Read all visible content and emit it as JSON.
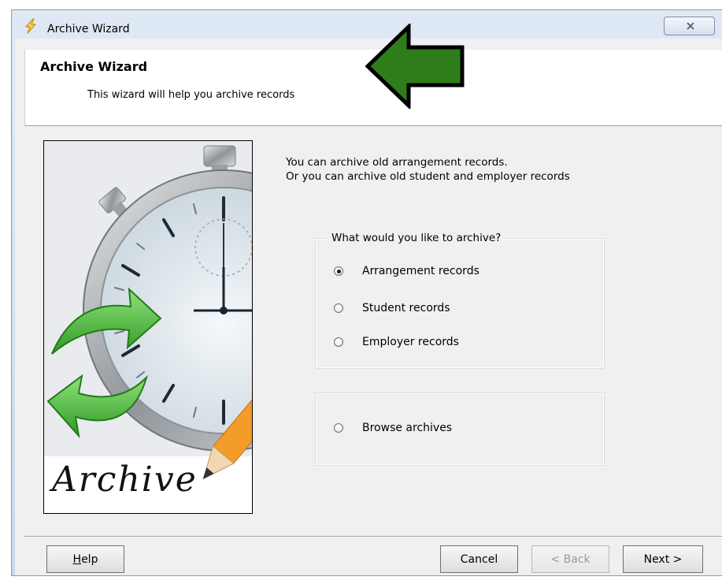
{
  "window": {
    "title": "Archive Wizard"
  },
  "header": {
    "title": "Archive Wizard",
    "subtitle": "This wizard will help you archive records"
  },
  "image": {
    "caption": "Archive"
  },
  "intro": {
    "line1": "You can archive old arrangement records.",
    "line2": "Or you can archive old student and employer records"
  },
  "archive_group": {
    "legend": "What would you  like to archive?",
    "options": [
      {
        "label": "Arrangement records",
        "checked": true
      },
      {
        "label": "Student records",
        "checked": false
      },
      {
        "label": "Employer records",
        "checked": false
      }
    ]
  },
  "browse_group": {
    "option": {
      "label": "Browse  archives",
      "checked": false
    }
  },
  "buttons": {
    "help": "Help",
    "cancel": "Cancel",
    "back": "< Back",
    "next": "Next >"
  },
  "colors": {
    "arrow_green": "#2e7d1a",
    "client_bg": "#f0f0f0"
  }
}
